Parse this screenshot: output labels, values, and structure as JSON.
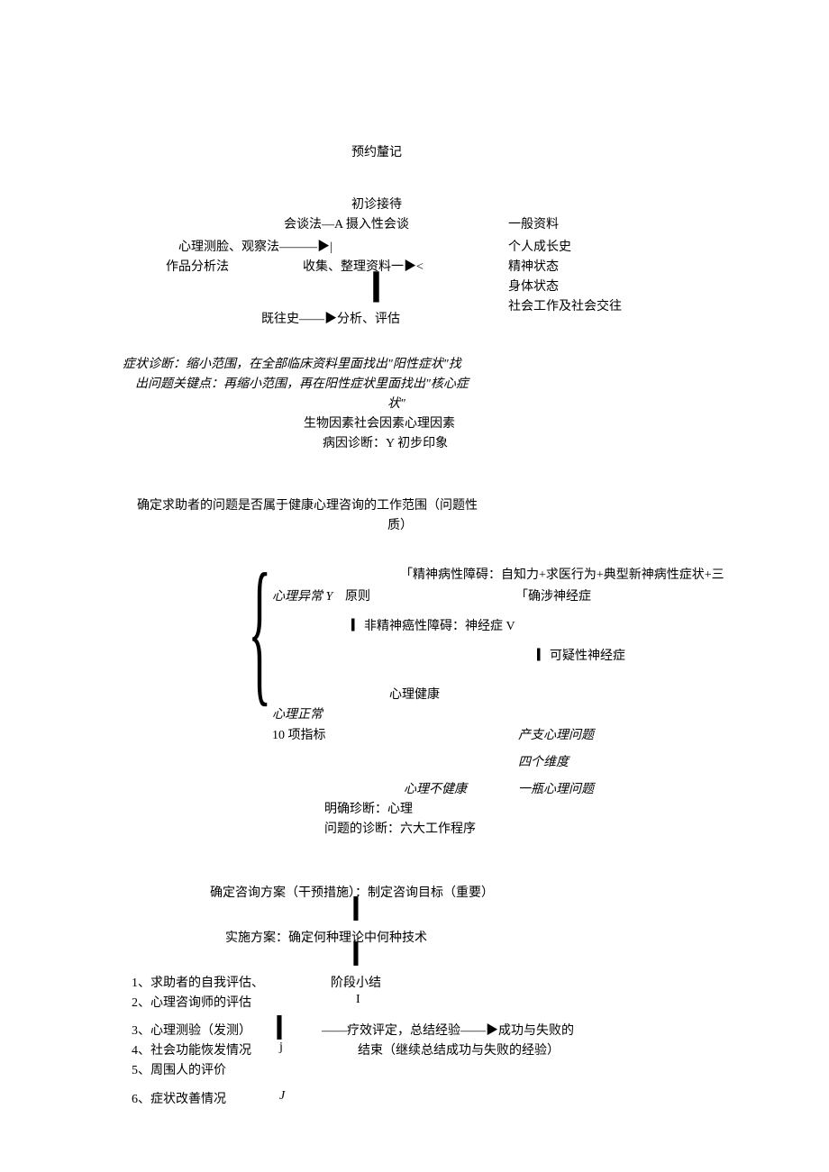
{
  "title": "预约釐记",
  "section1": {
    "line1": "初诊接待",
    "line2": "会谈法—A 摄入性会谈",
    "left_methods": "心理测脸、观察法———▶|",
    "left_methods2": "作品分析法",
    "collect": "收集、整理资料一▶<",
    "right1": "一般资料",
    "right2": "个人成长史",
    "right3": "精神状态",
    "right4": "身体状态",
    "right5": "社会工作及社会交往",
    "bar": "▎",
    "bottom": "既往史——▶分析、评估"
  },
  "section2": {
    "line1": "症状诊断：缩小范围，在全部临床资料里面找出\"阳性症状\"找",
    "line2": "出问题关键点：再缩小范围，再在阳性症状里面找出\"核心症",
    "line3": "状\"",
    "line4": "生物因素社会因素心理因素",
    "line5": "病因诊断：Y 初步印象"
  },
  "section3": {
    "line1": "确定求助者的问题是否属于健康心理咨询的工作范围（问题性",
    "line2": "质）"
  },
  "section4": {
    "top_right": "「精神病性障碍：自知力+求医行为+典型新神病性症状+三",
    "a1": "心理异常 Y",
    "a1b": "原则",
    "a1c": "「确涉神经症",
    "a2": "▎非精神癌性障碍：神经症 V",
    "a2b": "▎可疑性神经症",
    "mid": "心理健康",
    "b1": "心理正常",
    "b2": "10 项指标",
    "b2r": "产支心理问题",
    "b3r": "四个维度",
    "c1": "心理不健康",
    "c1r": "一瓶心理问题",
    "d1": "明确珍断：心理",
    "d2": "问题的诊断：六大工作程序"
  },
  "section5": {
    "s1": "确定咨询方案（干预措施）：制定咨询目标（重要）",
    "bar1": "▎",
    "s2": "实施方案：确定何种理论中何种技术",
    "bar2": "▎",
    "eval1": "1、求助者的自我评估、",
    "eval2": "2、心理咨询师的评估",
    "eval3": "3、心理测验（发测）",
    "eval4": "4、社会功能恢发情况",
    "eval5": "5、周围人的评价",
    "eval6": "6、症状改善情况",
    "mid_top": "阶段小结",
    "mid_top_bar": "I",
    "mid_bar": "▎",
    "mid_j": "j",
    "mid_arrow": "——疗效评定，总结经验——▶成功与失败的",
    "mid_end": "结束（继续总结成功与失败的经验）",
    "end_j": "J"
  }
}
